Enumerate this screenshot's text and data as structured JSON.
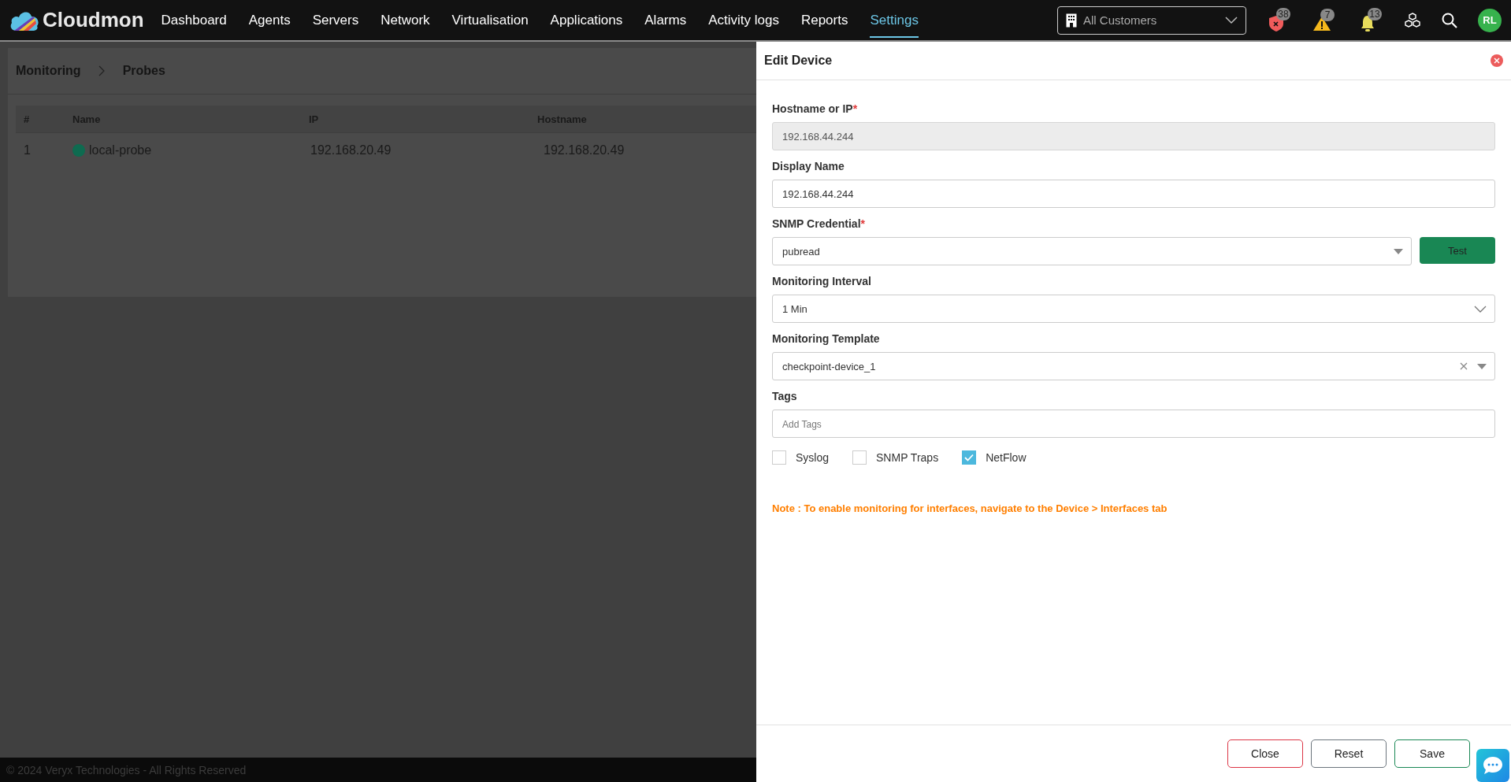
{
  "brand": {
    "name": "Cloudmon"
  },
  "nav": [
    {
      "label": "Dashboard",
      "selected": false
    },
    {
      "label": "Agents",
      "selected": false
    },
    {
      "label": "Servers",
      "selected": false
    },
    {
      "label": "Network",
      "selected": false
    },
    {
      "label": "Virtualisation",
      "selected": false
    },
    {
      "label": "Applications",
      "selected": false
    },
    {
      "label": "Alarms",
      "selected": false
    },
    {
      "label": "Activity logs",
      "selected": false
    },
    {
      "label": "Reports",
      "selected": false
    },
    {
      "label": "Settings",
      "selected": true
    }
  ],
  "customer_select": {
    "value": "All Customers"
  },
  "indicators": [
    {
      "kind": "shield",
      "count": "38"
    },
    {
      "kind": "warning",
      "count": "7"
    },
    {
      "kind": "bell",
      "count": "13"
    }
  ],
  "avatar": {
    "initials": "RL"
  },
  "breadcrumb": [
    "Monitoring",
    "Probes"
  ],
  "table": {
    "columns": [
      "#",
      "Name",
      "IP",
      "Hostname"
    ],
    "rows": [
      {
        "cells": [
          "1",
          "local-probe",
          "192.168.20.49",
          "192.168.20.49"
        ],
        "color": "#0e6b50"
      }
    ]
  },
  "footer": "© 2024 Veryx Technologies - All Rights Reserved",
  "panel": {
    "title": "Edit Device",
    "fields": [
      {
        "kind": "text",
        "label": "Hostname or IP",
        "required_mark": "*",
        "value": "192.168.44.244",
        "disabled": true
      },
      {
        "kind": "text",
        "label": "Display Name",
        "value": "192.168.44.244",
        "disabled": false
      },
      {
        "kind": "select_button",
        "label": "SNMP Credential",
        "required_mark": "*",
        "value": "pubread",
        "button": "Test"
      },
      {
        "kind": "dropdown",
        "label": "Monitoring Interval",
        "value": "1 Min"
      },
      {
        "kind": "clearable",
        "label": "Monitoring Template",
        "value": "checkpoint-device_1"
      },
      {
        "kind": "text",
        "label": "Tags",
        "placeholder": "Add Tags",
        "disabled": false
      }
    ],
    "checkboxes": [
      {
        "label": "Syslog",
        "checked": false
      },
      {
        "label": "SNMP Traps",
        "checked": false
      },
      {
        "label": "NetFlow",
        "checked": true
      }
    ],
    "note": "Note : To enable monitoring for interfaces, navigate to the Device > Interfaces tab",
    "buttons": [
      {
        "label": "Close",
        "kind": "close"
      },
      {
        "label": "Reset",
        "kind": "reset"
      },
      {
        "label": "Save",
        "kind": "save"
      }
    ]
  }
}
